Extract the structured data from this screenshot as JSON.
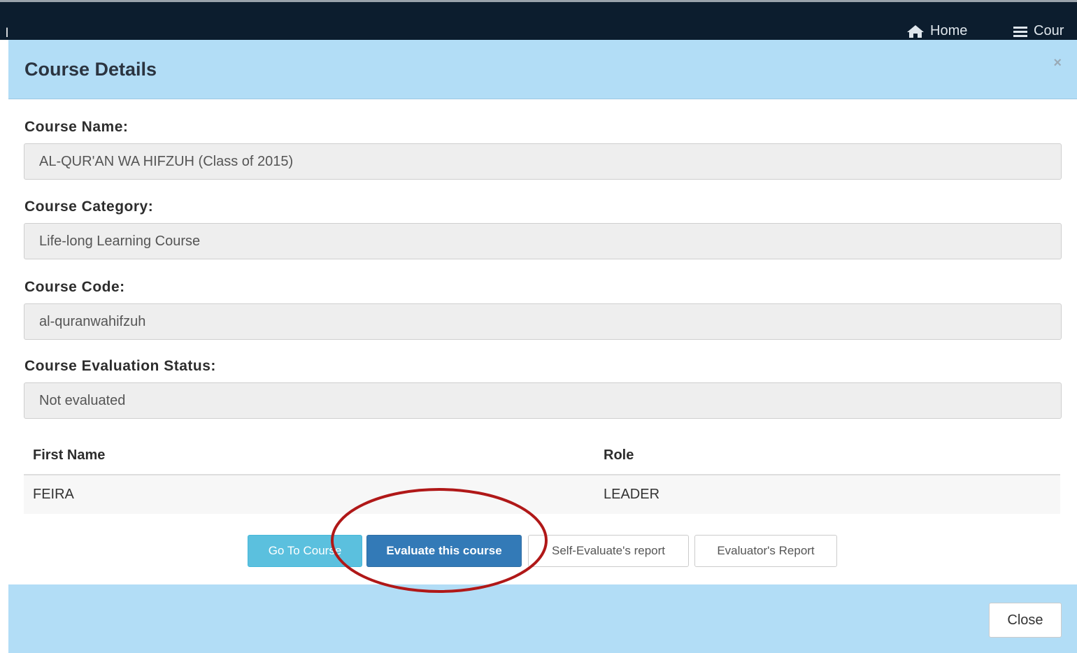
{
  "navbar": {
    "edge_char": "l",
    "home_label": "Home",
    "courses_label": "Cour"
  },
  "modal": {
    "title": "Course Details",
    "close_x": "×",
    "fields": [
      {
        "label": "Course Name:",
        "value": "AL-QUR'AN WA HIFZUH (Class of 2015)"
      },
      {
        "label": "Course Category:",
        "value": "Life-long Learning Course"
      },
      {
        "label": "Course Code:",
        "value": "al-quranwahifzuh"
      },
      {
        "label": "Course Evaluation Status:",
        "value": "Not evaluated"
      }
    ],
    "table": {
      "headers": [
        "First Name",
        "Role"
      ],
      "rows": [
        [
          "FEIRA",
          "LEADER"
        ]
      ]
    },
    "buttons": {
      "go_to_course": "Go To Course",
      "evaluate": "Evaluate this course",
      "self_report": "Self-Evaluate's report",
      "evaluator_report": "Evaluator's Report"
    },
    "footer": {
      "close_label": "Close"
    }
  },
  "colors": {
    "navbar_bg": "#0c1d2e",
    "modal_header_bg": "#b2ddf6",
    "info_button": "#5bc0de",
    "primary_button": "#337ab7",
    "annotation_circle": "#b01818"
  },
  "icons": {
    "home": "home-icon",
    "courses": "list-icon"
  }
}
